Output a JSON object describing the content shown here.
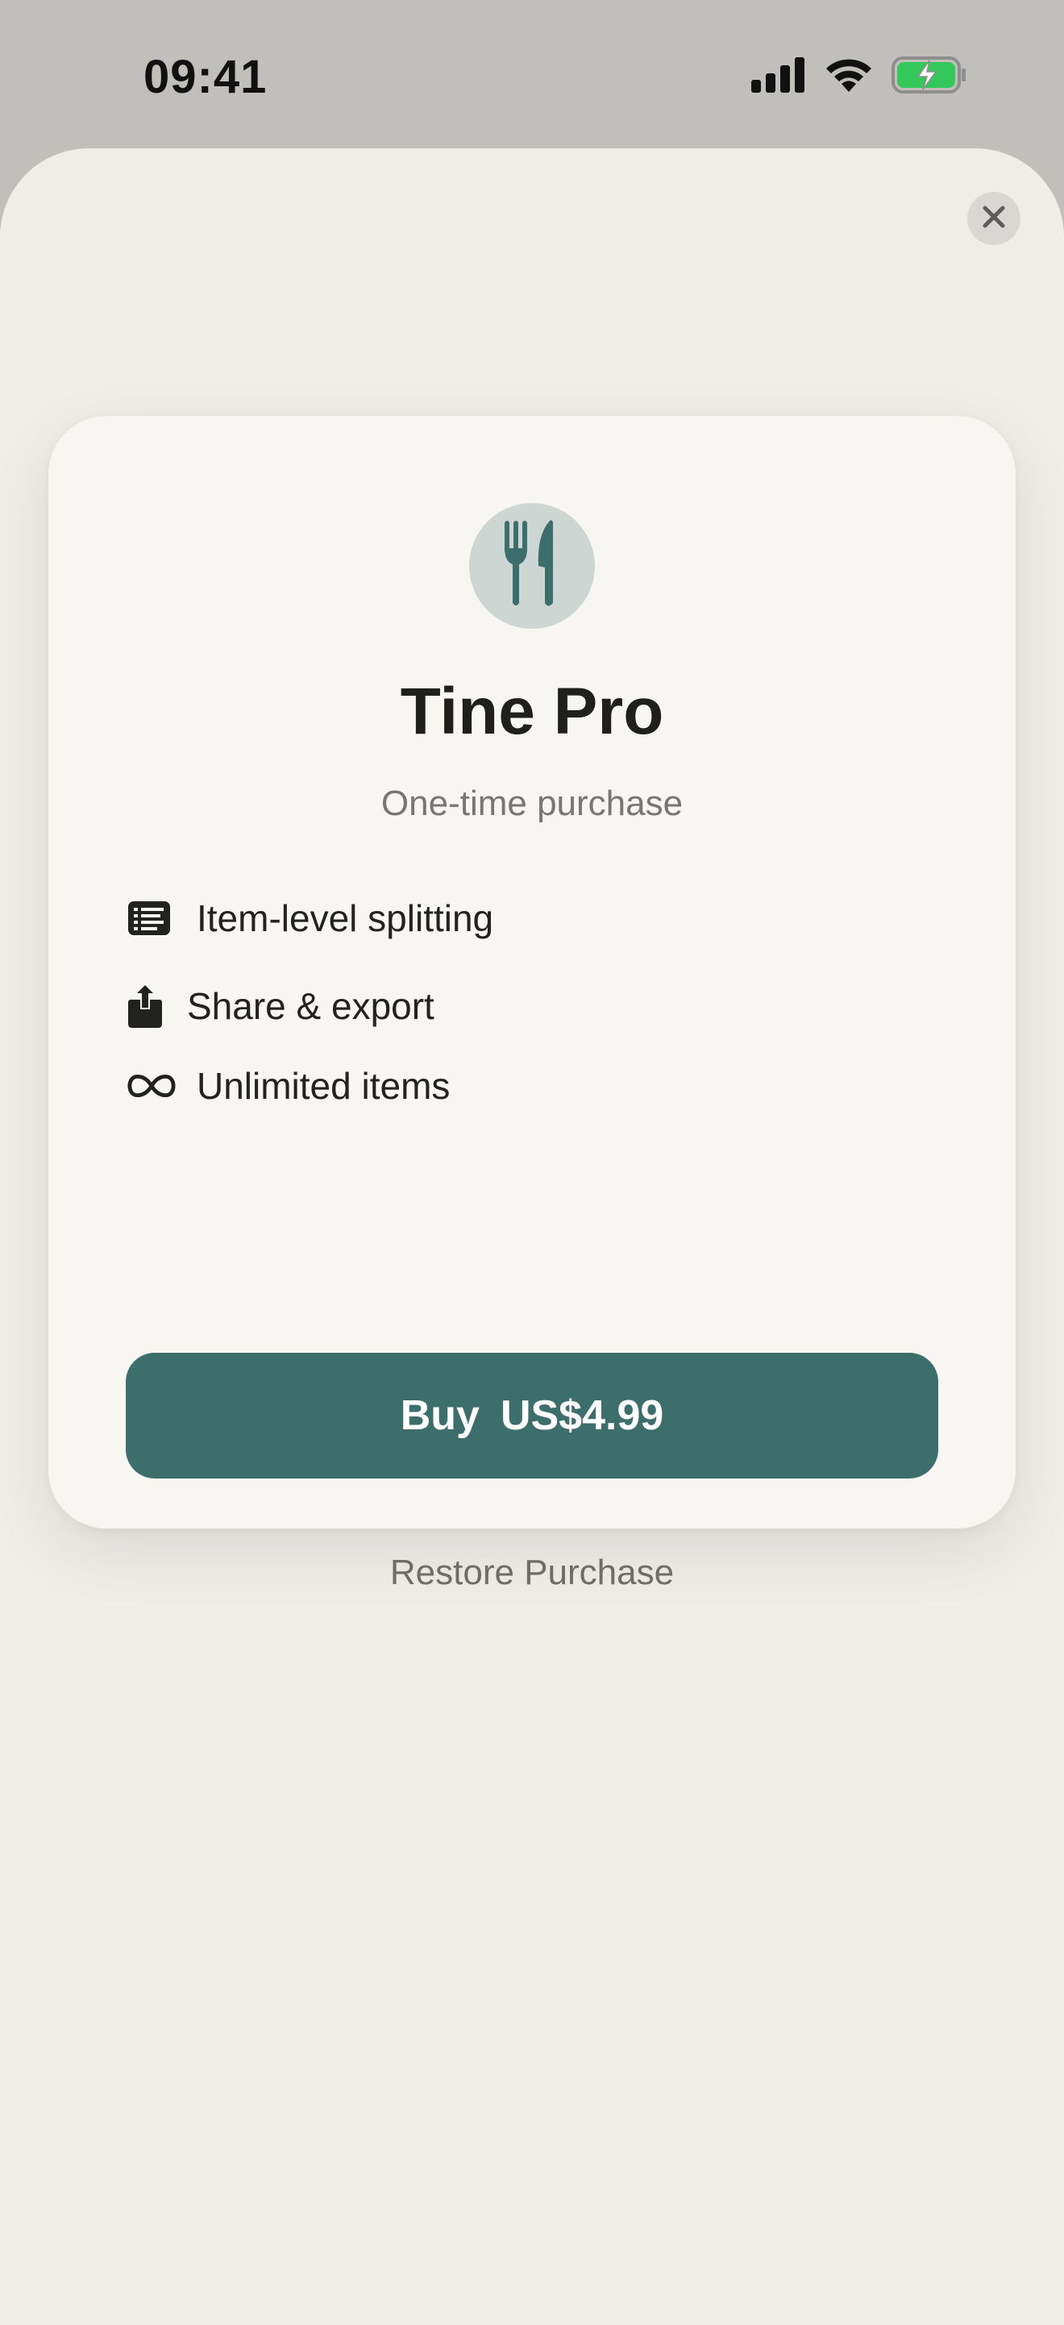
{
  "status_bar": {
    "time": "09:41",
    "icons": [
      "cellular-signal-icon",
      "wifi-icon",
      "battery-charging-icon"
    ],
    "battery_color": "#34c759"
  },
  "sheet": {
    "close_icon": "close-icon"
  },
  "paywall": {
    "app_icon": "fork-knife-icon",
    "title": "Tine Pro",
    "subtitle": "One-time purchase",
    "features": [
      {
        "icon": "list-icon",
        "label": "Item-level splitting"
      },
      {
        "icon": "share-icon",
        "label": "Share & export"
      },
      {
        "icon": "infinity-icon",
        "label": "Unlimited items"
      }
    ],
    "buy_button": {
      "label": "Buy",
      "price": "US$4.99"
    },
    "restore_label": "Restore Purchase"
  },
  "colors": {
    "accent": "#3c6e6b",
    "card_background": "#f7f6f2",
    "sheet_background": "#efede8",
    "icon_circle": "#cdd6d2"
  }
}
